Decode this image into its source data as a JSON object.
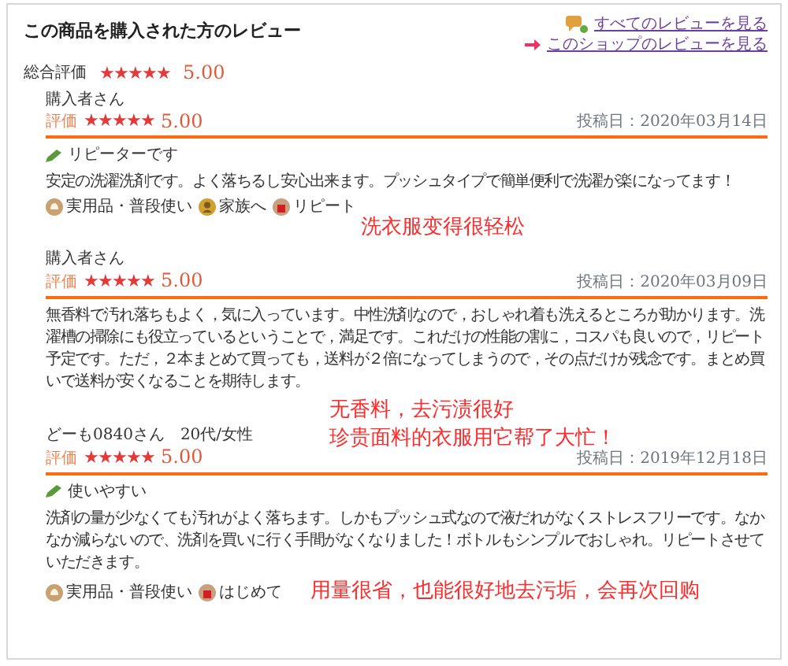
{
  "header": {
    "title": "この商品を購入された方のレビュー",
    "links": [
      {
        "kind": "chat",
        "text": "すべてのレビューを見る"
      },
      {
        "kind": "arrow",
        "text": "このショップのレビューを見る"
      }
    ]
  },
  "overall": {
    "label": "総合評価",
    "stars": 5,
    "score": "5.00"
  },
  "reviews": [
    {
      "reviewer": "購入者さん",
      "rating_label": "評価",
      "stars": 5,
      "score": "5.00",
      "date": "投稿日：2020年03月14日",
      "title": "リピーターです",
      "body": "安定の洗濯洗剤です。よく落ちるし安心出来ます。プッシュタイプで簡単便利で洗濯が楽になってます！",
      "tags": [
        {
          "kind": "hand",
          "text": "実用品・普段使い"
        },
        {
          "kind": "person",
          "text": "家族へ"
        },
        {
          "kind": "bag",
          "text": "リピート"
        }
      ],
      "annotation": [
        "洗衣服变得很轻松"
      ]
    },
    {
      "reviewer": "購入者さん",
      "rating_label": "評価",
      "stars": 5,
      "score": "5.00",
      "date": "投稿日：2020年03月09日",
      "body": "無香料で汚れ落ちもよく，気に入っています。中性洗剤なので，おしゃれ着も洗えるところが助かります。洗濯槽の掃除にも役立っているということで，満足です。これだけの性能の割に，コスパも良いので，リピート予定です。ただ，２本まとめて買っても，送料が２倍になってしまうので，その点だけが残念です。まとめ買いで送料が安くなることを期待します。",
      "annotation": [
        "无香料，去污渍很好",
        "珍贵面料的衣服用它帮了大忙！"
      ]
    },
    {
      "reviewer": "どーも0840さん　20代/女性",
      "rating_label": "評価",
      "stars": 5,
      "score": "5.00",
      "date": "投稿日：2019年12月18日",
      "title": "使いやすい",
      "body": "洗剤の量が少なくても汚れがよく落ちます。しかもプッシュ式なので液だれがなくストレスフリーです。なかなか減らないので、洗剤を買いに行く手間がなくなりました！ボトルもシンプルでおしゃれ。リピートさせていただきます。",
      "tags": [
        {
          "kind": "hand",
          "text": "実用品・普段使い"
        },
        {
          "kind": "bag",
          "text": "はじめて"
        }
      ],
      "annotation": [
        "用量很省，也能很好地去污垢，会再次回购"
      ]
    }
  ]
}
